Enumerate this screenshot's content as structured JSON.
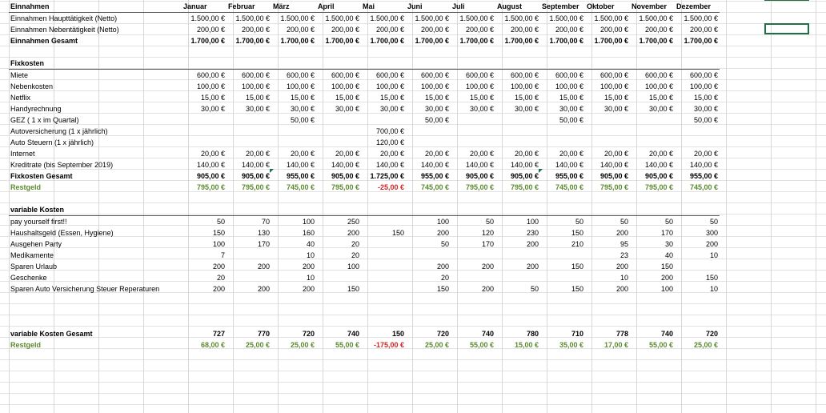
{
  "header": {
    "label": "Einnahmen",
    "months": [
      "Januar",
      "Februar",
      "März",
      "April",
      "Mai",
      "Juni",
      "Juli",
      "August",
      "September",
      "Oktober",
      "November",
      "Dezember"
    ]
  },
  "income": [
    {
      "label": "Einnahmen Haupttätigkeit (Netto)",
      "values": [
        "1.500,00 €",
        "1.500,00 €",
        "1.500,00 €",
        "1.500,00 €",
        "1.500,00 €",
        "1.500,00 €",
        "1.500,00 €",
        "1.500,00 €",
        "1.500,00 €",
        "1.500,00 €",
        "1.500,00 €",
        "1.500,00 €"
      ]
    },
    {
      "label": "Einnahmen Nebentätigkeit (Netto)",
      "values": [
        "200,00 €",
        "200,00 €",
        "200,00 €",
        "200,00 €",
        "200,00 €",
        "200,00 €",
        "200,00 €",
        "200,00 €",
        "200,00 €",
        "200,00 €",
        "200,00 €",
        "200,00 €"
      ]
    }
  ],
  "income_total": {
    "label": "Einnahmen Gesamt",
    "values": [
      "1.700,00 €",
      "1.700,00 €",
      "1.700,00 €",
      "1.700,00 €",
      "1.700,00 €",
      "1.700,00 €",
      "1.700,00 €",
      "1.700,00 €",
      "1.700,00 €",
      "1.700,00 €",
      "1.700,00 €",
      "1.700,00 €"
    ]
  },
  "fixed_title": "Fixkosten",
  "fixed": [
    {
      "label": "Miete",
      "values": [
        "600,00 €",
        "600,00 €",
        "600,00 €",
        "600,00 €",
        "600,00 €",
        "600,00 €",
        "600,00 €",
        "600,00 €",
        "600,00 €",
        "600,00 €",
        "600,00 €",
        "600,00 €"
      ]
    },
    {
      "label": "Nebenkosten",
      "values": [
        "100,00 €",
        "100,00 €",
        "100,00 €",
        "100,00 €",
        "100,00 €",
        "100,00 €",
        "100,00 €",
        "100,00 €",
        "100,00 €",
        "100,00 €",
        "100,00 €",
        "100,00 €"
      ]
    },
    {
      "label": "Netflix",
      "values": [
        "15,00 €",
        "15,00 €",
        "15,00 €",
        "15,00 €",
        "15,00 €",
        "15,00 €",
        "15,00 €",
        "15,00 €",
        "15,00 €",
        "15,00 €",
        "15,00 €",
        "15,00 €"
      ]
    },
    {
      "label": "Handyrechnung",
      "values": [
        "30,00 €",
        "30,00 €",
        "30,00 €",
        "30,00 €",
        "30,00 €",
        "30,00 €",
        "30,00 €",
        "30,00 €",
        "30,00 €",
        "30,00 €",
        "30,00 €",
        "30,00 €"
      ]
    },
    {
      "label": "GEZ ( 1 x im Quartal)",
      "values": [
        "",
        "",
        "50,00 €",
        "",
        "",
        "50,00 €",
        "",
        "",
        "50,00 €",
        "",
        "",
        "50,00 €"
      ]
    },
    {
      "label": "Autoversicherung (1 x jährlich)",
      "values": [
        "",
        "",
        "",
        "",
        "700,00 €",
        "",
        "",
        "",
        "",
        "",
        "",
        ""
      ]
    },
    {
      "label": "Auto Steuern (1 x jährlich)",
      "values": [
        "",
        "",
        "",
        "",
        "120,00 €",
        "",
        "",
        "",
        "",
        "",
        "",
        ""
      ]
    },
    {
      "label": "Internet",
      "values": [
        "20,00 €",
        "20,00 €",
        "20,00 €",
        "20,00 €",
        "20,00 €",
        "20,00 €",
        "20,00 €",
        "20,00 €",
        "20,00 €",
        "20,00 €",
        "20,00 €",
        "20,00 €"
      ]
    },
    {
      "label": "Kreditrate (bis September 2019)",
      "values": [
        "140,00 €",
        "140,00 €",
        "140,00 €",
        "140,00 €",
        "140,00 €",
        "140,00 €",
        "140,00 €",
        "140,00 €",
        "140,00 €",
        "140,00 €",
        "140,00 €",
        "140,00 €"
      ]
    }
  ],
  "fixed_total": {
    "label": "Fixkosten Gesamt",
    "values": [
      "905,00 €",
      "905,00 €",
      "955,00 €",
      "905,00 €",
      "1.725,00 €",
      "955,00 €",
      "905,00 €",
      "905,00 €",
      "955,00 €",
      "905,00 €",
      "905,00 €",
      "955,00 €"
    ]
  },
  "fixed_rest": {
    "label": "Restgeld",
    "values": [
      "795,00 €",
      "795,00 €",
      "745,00 €",
      "795,00 €",
      "-25,00 €",
      "745,00 €",
      "795,00 €",
      "795,00 €",
      "745,00 €",
      "795,00 €",
      "795,00 €",
      "745,00 €"
    ]
  },
  "variable_title": "variable Kosten",
  "variable": [
    {
      "label": "pay yourself first!!",
      "values": [
        "50",
        "70",
        "100",
        "250",
        "",
        "100",
        "50",
        "100",
        "50",
        "50",
        "50",
        "50"
      ]
    },
    {
      "label": "Haushaltsgeld (Essen, Hygiene)",
      "values": [
        "150",
        "130",
        "160",
        "200",
        "150",
        "200",
        "120",
        "230",
        "150",
        "200",
        "170",
        "300"
      ]
    },
    {
      "label": "Ausgehen Party",
      "values": [
        "100",
        "170",
        "40",
        "20",
        "",
        "50",
        "170",
        "200",
        "210",
        "95",
        "30",
        "200"
      ]
    },
    {
      "label": "Medikamente",
      "values": [
        "7",
        "",
        "10",
        "20",
        "",
        "",
        "",
        "",
        "",
        "23",
        "40",
        "10"
      ]
    },
    {
      "label": "Sparen Urlaub",
      "values": [
        "200",
        "200",
        "200",
        "100",
        "",
        "200",
        "200",
        "200",
        "150",
        "200",
        "150",
        ""
      ]
    },
    {
      "label": "Geschenke",
      "values": [
        "20",
        "",
        "10",
        "",
        "",
        "20",
        "",
        "",
        "",
        "10",
        "200",
        "150"
      ]
    },
    {
      "label": "Sparen Auto Versicherung Steuer Reperaturen",
      "values": [
        "200",
        "200",
        "200",
        "150",
        "",
        "150",
        "200",
        "50",
        "150",
        "200",
        "100",
        "10"
      ]
    }
  ],
  "variable_total": {
    "label": "variable Kosten Gesamt",
    "values": [
      "727",
      "770",
      "720",
      "740",
      "150",
      "720",
      "740",
      "780",
      "710",
      "778",
      "740",
      "720"
    ]
  },
  "variable_rest": {
    "label": "Restgeld",
    "values": [
      "68,00 €",
      "25,00 €",
      "25,00 €",
      "55,00 €",
      "-175,00 €",
      "25,00 €",
      "55,00 €",
      "15,00 €",
      "35,00 €",
      "17,00 €",
      "55,00 €",
      "25,00 €"
    ]
  },
  "colors": {
    "positive": "#5b8a2e",
    "negative": "#d4231f",
    "selection": "#1e7145"
  }
}
